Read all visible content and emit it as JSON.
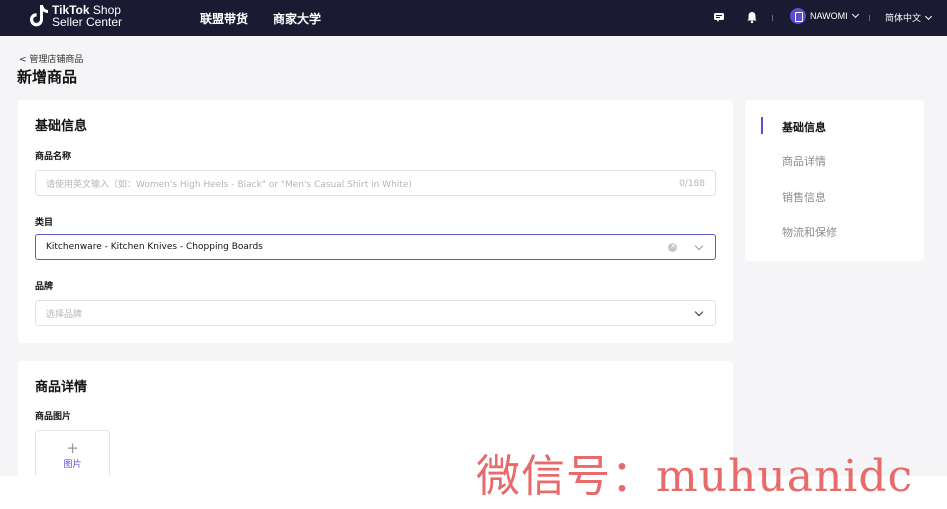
{
  "header": {
    "logo_brand": "TikTok",
    "logo_brand_suffix": "Shop",
    "logo_sub": "Seller Center",
    "nav": [
      "联盟带货",
      "商家大学"
    ],
    "user": "NAWOMI",
    "language": "简体中文",
    "icons": [
      "message-icon",
      "bell-icon",
      "avatar-icon"
    ]
  },
  "breadcrumb": "< 管理店铺商品",
  "page_title": "新增商品",
  "basic_info": {
    "title": "基础信息",
    "name_label": "商品名称",
    "name_placeholder": "请使用英文输入（如：Women's High Heels - Black\" or \"Men's Casual Shirt in White)",
    "name_counter": "0/188",
    "category_label": "类目",
    "category_value": "Kitchenware - Kitchen Knives - Chopping Boards",
    "brand_label": "品牌",
    "brand_placeholder": "选择品牌"
  },
  "product_detail": {
    "title": "商品详情",
    "images_label": "商品图片",
    "upload_plus": "+",
    "upload_label": "图片"
  },
  "side_nav": {
    "items": [
      "基础信息",
      "商品详情",
      "销售信息",
      "物流和保修"
    ],
    "active_index": 0
  },
  "watermark": "微信号：muhuanidc",
  "colors": {
    "topbar": "#1a1a33",
    "accent": "#5b4fd1",
    "watermark": "#e76b6b"
  }
}
